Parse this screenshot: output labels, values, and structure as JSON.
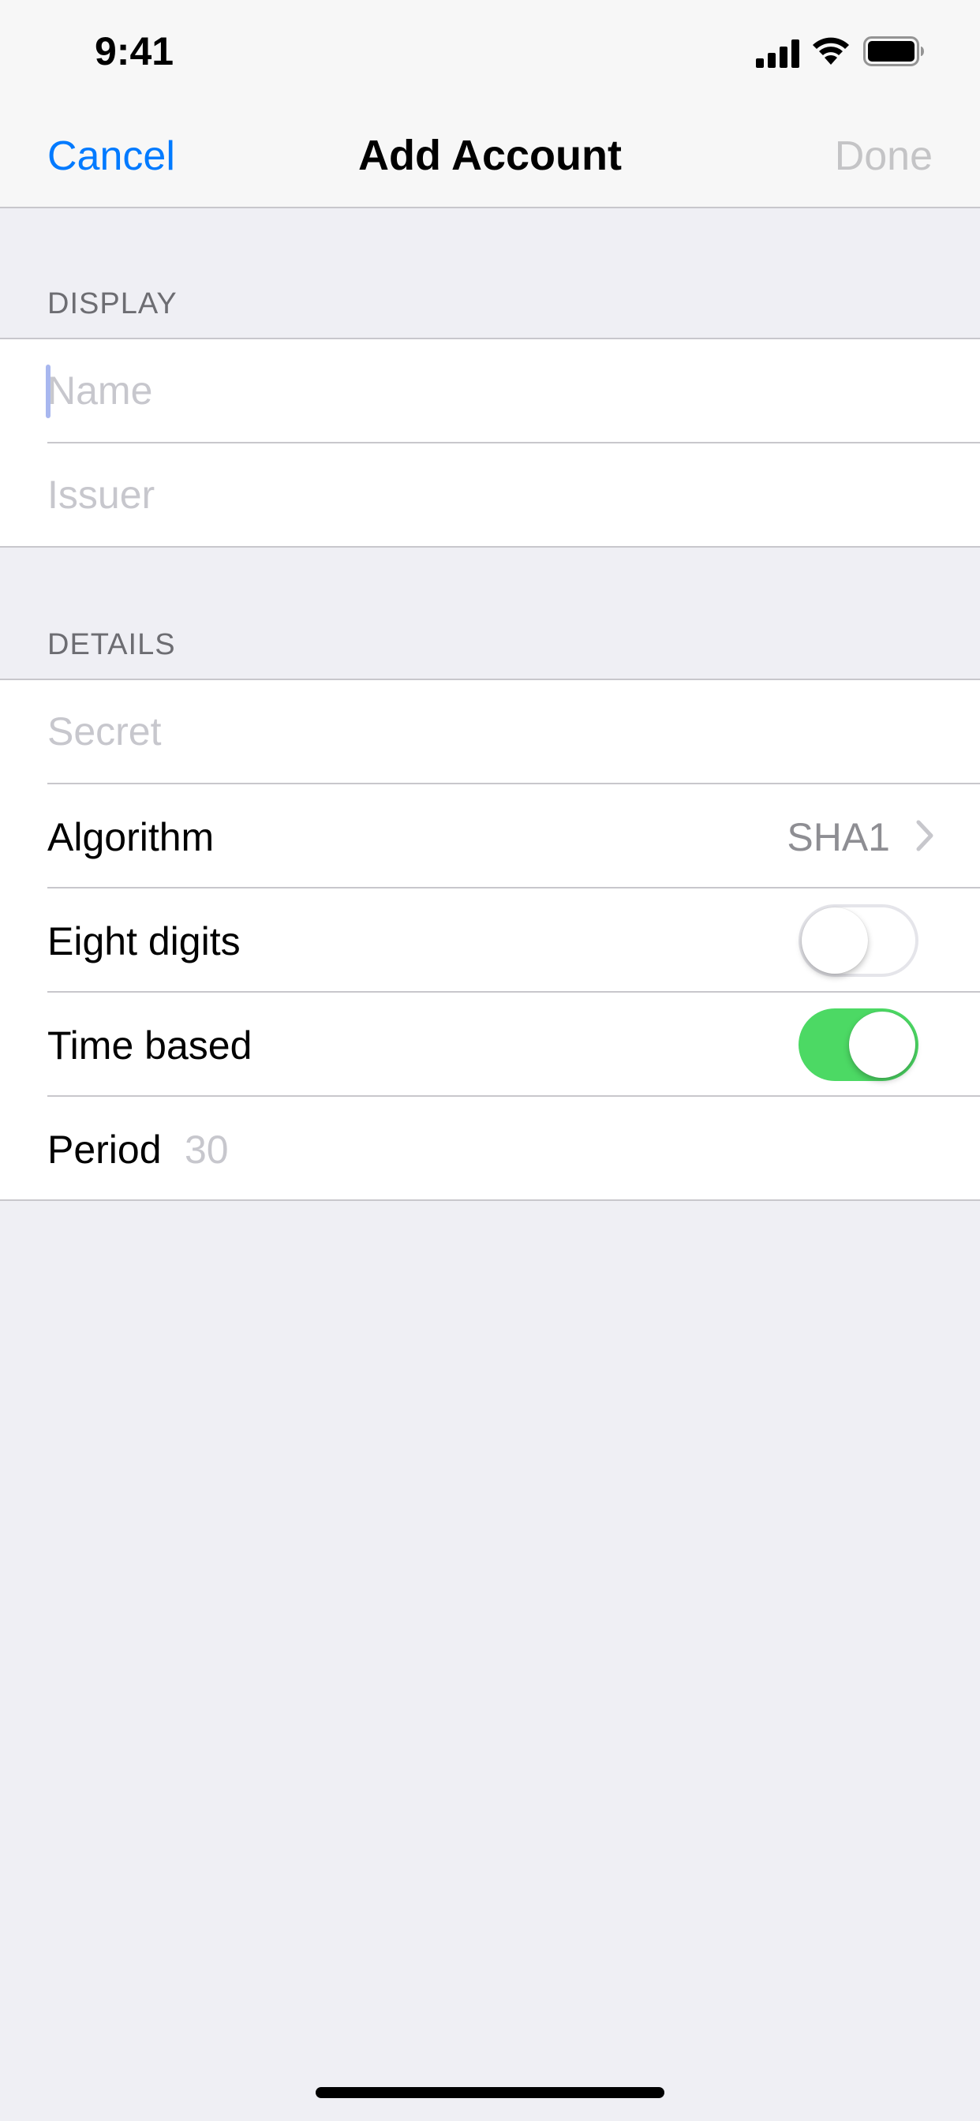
{
  "status_bar": {
    "time": "9:41",
    "icons": [
      "cellular-signal-icon",
      "wifi-icon",
      "battery-icon"
    ]
  },
  "nav": {
    "cancel_label": "Cancel",
    "title": "Add Account",
    "done_label": "Done"
  },
  "sections": {
    "display": {
      "header": "DISPLAY",
      "name_placeholder": "Name",
      "name_value": "",
      "issuer_placeholder": "Issuer",
      "issuer_value": ""
    },
    "details": {
      "header": "DETAILS",
      "secret_placeholder": "Secret",
      "secret_value": "",
      "algorithm_label": "Algorithm",
      "algorithm_value": "SHA1",
      "eight_digits_label": "Eight digits",
      "eight_digits_on": false,
      "time_based_label": "Time based",
      "time_based_on": true,
      "period_label": "Period",
      "period_value": "30"
    }
  },
  "colors": {
    "accent": "#007aff",
    "toggle_on": "#4cd964",
    "disabled": "#c4c4c6",
    "background": "#efeff4"
  }
}
